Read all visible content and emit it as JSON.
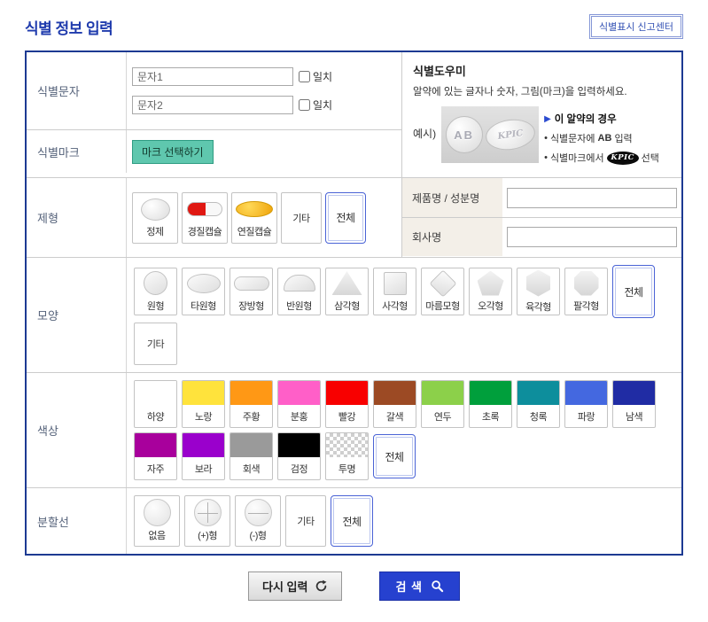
{
  "header": {
    "title": "식별 정보 입력",
    "report_button": "식별표시 신고센터"
  },
  "id_char": {
    "label": "식별문자",
    "field1_value": "문자1",
    "field2_value": "문자2",
    "match_label": "일치"
  },
  "id_mark": {
    "label": "식별마크",
    "select_button": "마크 선택하기"
  },
  "helper": {
    "title": "식별도우미",
    "description": "알약에 있는 글자나 숫자, 그림(마크)을 입력하세요.",
    "example_label": "예시)",
    "pill1_text": "AB",
    "pill2_text": "KPIC",
    "case_arrow": "▶",
    "case_title": "이 알약의 경우",
    "bullet": "•",
    "note1_prefix": "식별문자에",
    "note1_strong": "AB",
    "note1_suffix": "입력",
    "note2_prefix": "식별마크에서",
    "note2_logo": "KPIC",
    "note2_suffix": "선택"
  },
  "product": {
    "name_label": "제품명 / 성분명",
    "company_label": "회사명"
  },
  "dosage_form": {
    "label": "제형",
    "options": [
      {
        "name": "정제",
        "icon": "tablet-icon"
      },
      {
        "name": "경질캡슐",
        "icon": "hard-capsule-icon"
      },
      {
        "name": "연질캡슐",
        "icon": "soft-capsule-icon"
      },
      {
        "name": "기타"
      },
      {
        "name": "전체",
        "selected": true
      }
    ]
  },
  "shape": {
    "label": "모양",
    "options": [
      {
        "name": "원형",
        "icon": "circle-shape-icon"
      },
      {
        "name": "타원형",
        "icon": "ellipse-shape-icon"
      },
      {
        "name": "장방형",
        "icon": "oblong-shape-icon"
      },
      {
        "name": "반원형",
        "icon": "semicircle-shape-icon"
      },
      {
        "name": "삼각형",
        "icon": "triangle-shape-icon"
      },
      {
        "name": "사각형",
        "icon": "square-shape-icon"
      },
      {
        "name": "마름모형",
        "icon": "diamond-shape-icon"
      },
      {
        "name": "오각형",
        "icon": "pentagon-shape-icon"
      },
      {
        "name": "육각형",
        "icon": "hexagon-shape-icon"
      },
      {
        "name": "팔각형",
        "icon": "octagon-shape-icon"
      },
      {
        "name": "전체",
        "selected": true
      },
      {
        "name": "기타"
      }
    ]
  },
  "color": {
    "label": "색상",
    "options": [
      {
        "name": "하양",
        "hex": "#ffffff"
      },
      {
        "name": "노랑",
        "hex": "#ffe33c"
      },
      {
        "name": "주황",
        "hex": "#ff9815"
      },
      {
        "name": "분홍",
        "hex": "#ff5fc8"
      },
      {
        "name": "빨강",
        "hex": "#f80000"
      },
      {
        "name": "갈색",
        "hex": "#9c4a24"
      },
      {
        "name": "연두",
        "hex": "#8cd04a"
      },
      {
        "name": "초록",
        "hex": "#009f3c"
      },
      {
        "name": "청록",
        "hex": "#0d8e9c"
      },
      {
        "name": "파랑",
        "hex": "#4468e0"
      },
      {
        "name": "남색",
        "hex": "#202ca4"
      },
      {
        "name": "자주",
        "hex": "#a8009c"
      },
      {
        "name": "보라",
        "hex": "#9a00cc"
      },
      {
        "name": "회색",
        "hex": "#9a9a9a"
      },
      {
        "name": "검정",
        "hex": "#000000"
      },
      {
        "name": "투명",
        "pattern": "checker"
      },
      {
        "name": "전체",
        "selected": true
      }
    ]
  },
  "score_line": {
    "label": "분할선",
    "options": [
      {
        "name": "없음",
        "icon": "no-score-icon"
      },
      {
        "name": "(+)형",
        "icon": "plus-score-icon"
      },
      {
        "name": "(-)형",
        "icon": "minus-score-icon"
      },
      {
        "name": "기타"
      },
      {
        "name": "전체",
        "selected": true
      }
    ]
  },
  "footer": {
    "reset_button": "다시 입력",
    "search_button": "검 색"
  },
  "theme": {
    "accent_blue": "#1f3bad",
    "panel_border": "#1d3a92",
    "selected_border": "#4a63d6",
    "mark_button_bg": "#5fc7ae",
    "search_button_bg": "#2641cf"
  }
}
